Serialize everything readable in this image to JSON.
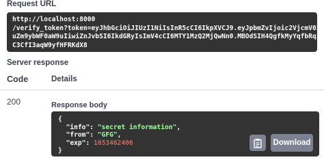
{
  "request": {
    "label": "Request URL",
    "url_lines": [
      "http://localhost:8000",
      "/verify_token?token=eyJhbGciOiJIUzI1NiIsInR5cCI6IkpXVCJ9.eyJpbmZvIjoic2VjcmV0IG1",
      "uZm9ybWF0aW9uIiwiZnJvbSI6IkdGRyIsImV4cCI6MTY1MzQ2MjQwNn0.MBOdSIH4QgfkMyYqfbRq1e0",
      "C3CfI3aqW9yfHFRKdX8"
    ]
  },
  "server_response": {
    "label": "Server response",
    "code_header": "Code",
    "details_header": "Details",
    "code": "200",
    "response_body_label": "Response body",
    "body": {
      "open": "{",
      "lines": [
        {
          "key": "\"info\"",
          "value": "\"secret information\"",
          "type": "string",
          "trail": ","
        },
        {
          "key": "\"from\"",
          "value": "\"GFG\"",
          "type": "string",
          "trail": ","
        },
        {
          "key": "\"exp\"",
          "value": "1653462406",
          "type": "number",
          "trail": ""
        }
      ],
      "close": "}"
    },
    "download_label": "Download",
    "copy_icon": "clipboard-copy-icon"
  }
}
